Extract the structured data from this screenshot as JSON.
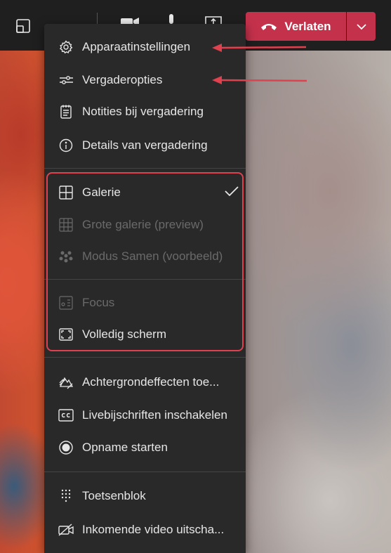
{
  "topbar": {
    "leave_label": "Verlaten"
  },
  "menu": {
    "settings": [
      {
        "label": "Apparaatinstellingen",
        "icon": "gear-icon"
      },
      {
        "label": "Vergaderopties",
        "icon": "sliders-icon"
      },
      {
        "label": "Notities bij vergadering",
        "icon": "notes-icon"
      },
      {
        "label": "Details van vergadering",
        "icon": "info-icon"
      }
    ],
    "views": [
      {
        "label": "Galerie",
        "icon": "gallery-icon",
        "checked": true
      },
      {
        "label": "Grote galerie (preview)",
        "icon": "large-gallery-icon",
        "disabled": true
      },
      {
        "label": "Modus Samen (voorbeeld)",
        "icon": "together-mode-icon",
        "disabled": true
      },
      {
        "label": "Focus",
        "icon": "focus-icon",
        "disabled": true
      },
      {
        "label": "Volledig scherm",
        "icon": "fullscreen-icon"
      }
    ],
    "actions": [
      {
        "label": "Achtergrondeffecten toe...",
        "icon": "background-effects-icon"
      },
      {
        "label": "Livebijschriften inschakelen",
        "icon": "captions-icon"
      },
      {
        "label": "Opname starten",
        "icon": "record-icon"
      },
      {
        "label": "Toetsenblok",
        "icon": "keypad-icon"
      },
      {
        "label": "Inkomende video uitscha...",
        "icon": "video-off-icon"
      }
    ]
  },
  "colors": {
    "leave_red": "#c4314b",
    "annotation_red": "#e0414f"
  }
}
